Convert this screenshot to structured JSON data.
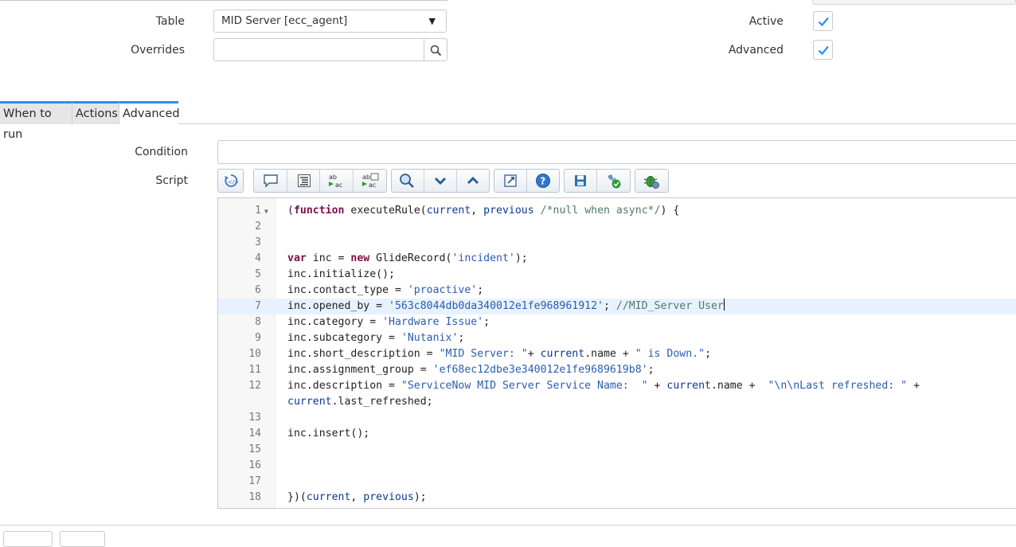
{
  "form": {
    "table_label": "Table",
    "table_value": "MID Server [ecc_agent]",
    "overrides_label": "Overrides",
    "overrides_value": "",
    "active_label": "Active",
    "active_checked": true,
    "advanced_label": "Advanced",
    "advanced_checked": true
  },
  "tabs": [
    {
      "label": "When to run",
      "active": false
    },
    {
      "label": "Actions",
      "active": false
    },
    {
      "label": "Advanced",
      "active": true
    }
  ],
  "advanced": {
    "condition_label": "Condition",
    "condition_value": "",
    "script_label": "Script"
  },
  "toolbar": {
    "icons": [
      "toggle-syntax-editor-icon",
      "comment-icon",
      "format-code-icon",
      "replace-icon",
      "replace-all-icon",
      "search-icon",
      "find-next-icon",
      "find-previous-icon",
      "fullscreen-icon",
      "help-icon",
      "save-icon",
      "check-syntax-icon",
      "debug-icon"
    ]
  },
  "editor": {
    "highlighted_line": 7,
    "lines": [
      {
        "n": "1",
        "text": "(function executeRule(current, previous /*null when async*/) {",
        "fold": true
      },
      {
        "n": "2",
        "text": ""
      },
      {
        "n": "3",
        "text": ""
      },
      {
        "n": "4",
        "text": "var inc = new GlideRecord('incident');"
      },
      {
        "n": "5",
        "text": "inc.initialize();"
      },
      {
        "n": "6",
        "text": "inc.contact_type = 'proactive';"
      },
      {
        "n": "7",
        "text": "inc.opened_by = '563c8044db0da340012e1fe968961912'; //MID_Server User"
      },
      {
        "n": "8",
        "text": "inc.category = 'Hardware Issue';"
      },
      {
        "n": "9",
        "text": "inc.subcategory = 'Nutanix';"
      },
      {
        "n": "10",
        "text": "inc.short_description = \"MID Server: \"+ current.name + \" is Down.\";"
      },
      {
        "n": "11",
        "text": "inc.assignment_group = 'ef68ec12dbe3e340012e1fe9689619b8';"
      },
      {
        "n": "12",
        "text": "inc.description = \"ServiceNow MID Server Service Name:  \" + current.name +  \"\\n\\nLast refreshed: \" +"
      },
      {
        "n": "",
        "text": "current.last_refreshed;"
      },
      {
        "n": "13",
        "text": ""
      },
      {
        "n": "14",
        "text": "inc.insert();"
      },
      {
        "n": "15",
        "text": ""
      },
      {
        "n": "16",
        "text": ""
      },
      {
        "n": "17",
        "text": ""
      },
      {
        "n": "18",
        "text": "})(current, previous);"
      }
    ]
  },
  "colors": {
    "tab_accent": "#278efc",
    "checkbox_check": "#278efc",
    "keyword": "#7a0f4d",
    "string": "#2a5db0",
    "comment": "#4f7a6a"
  }
}
